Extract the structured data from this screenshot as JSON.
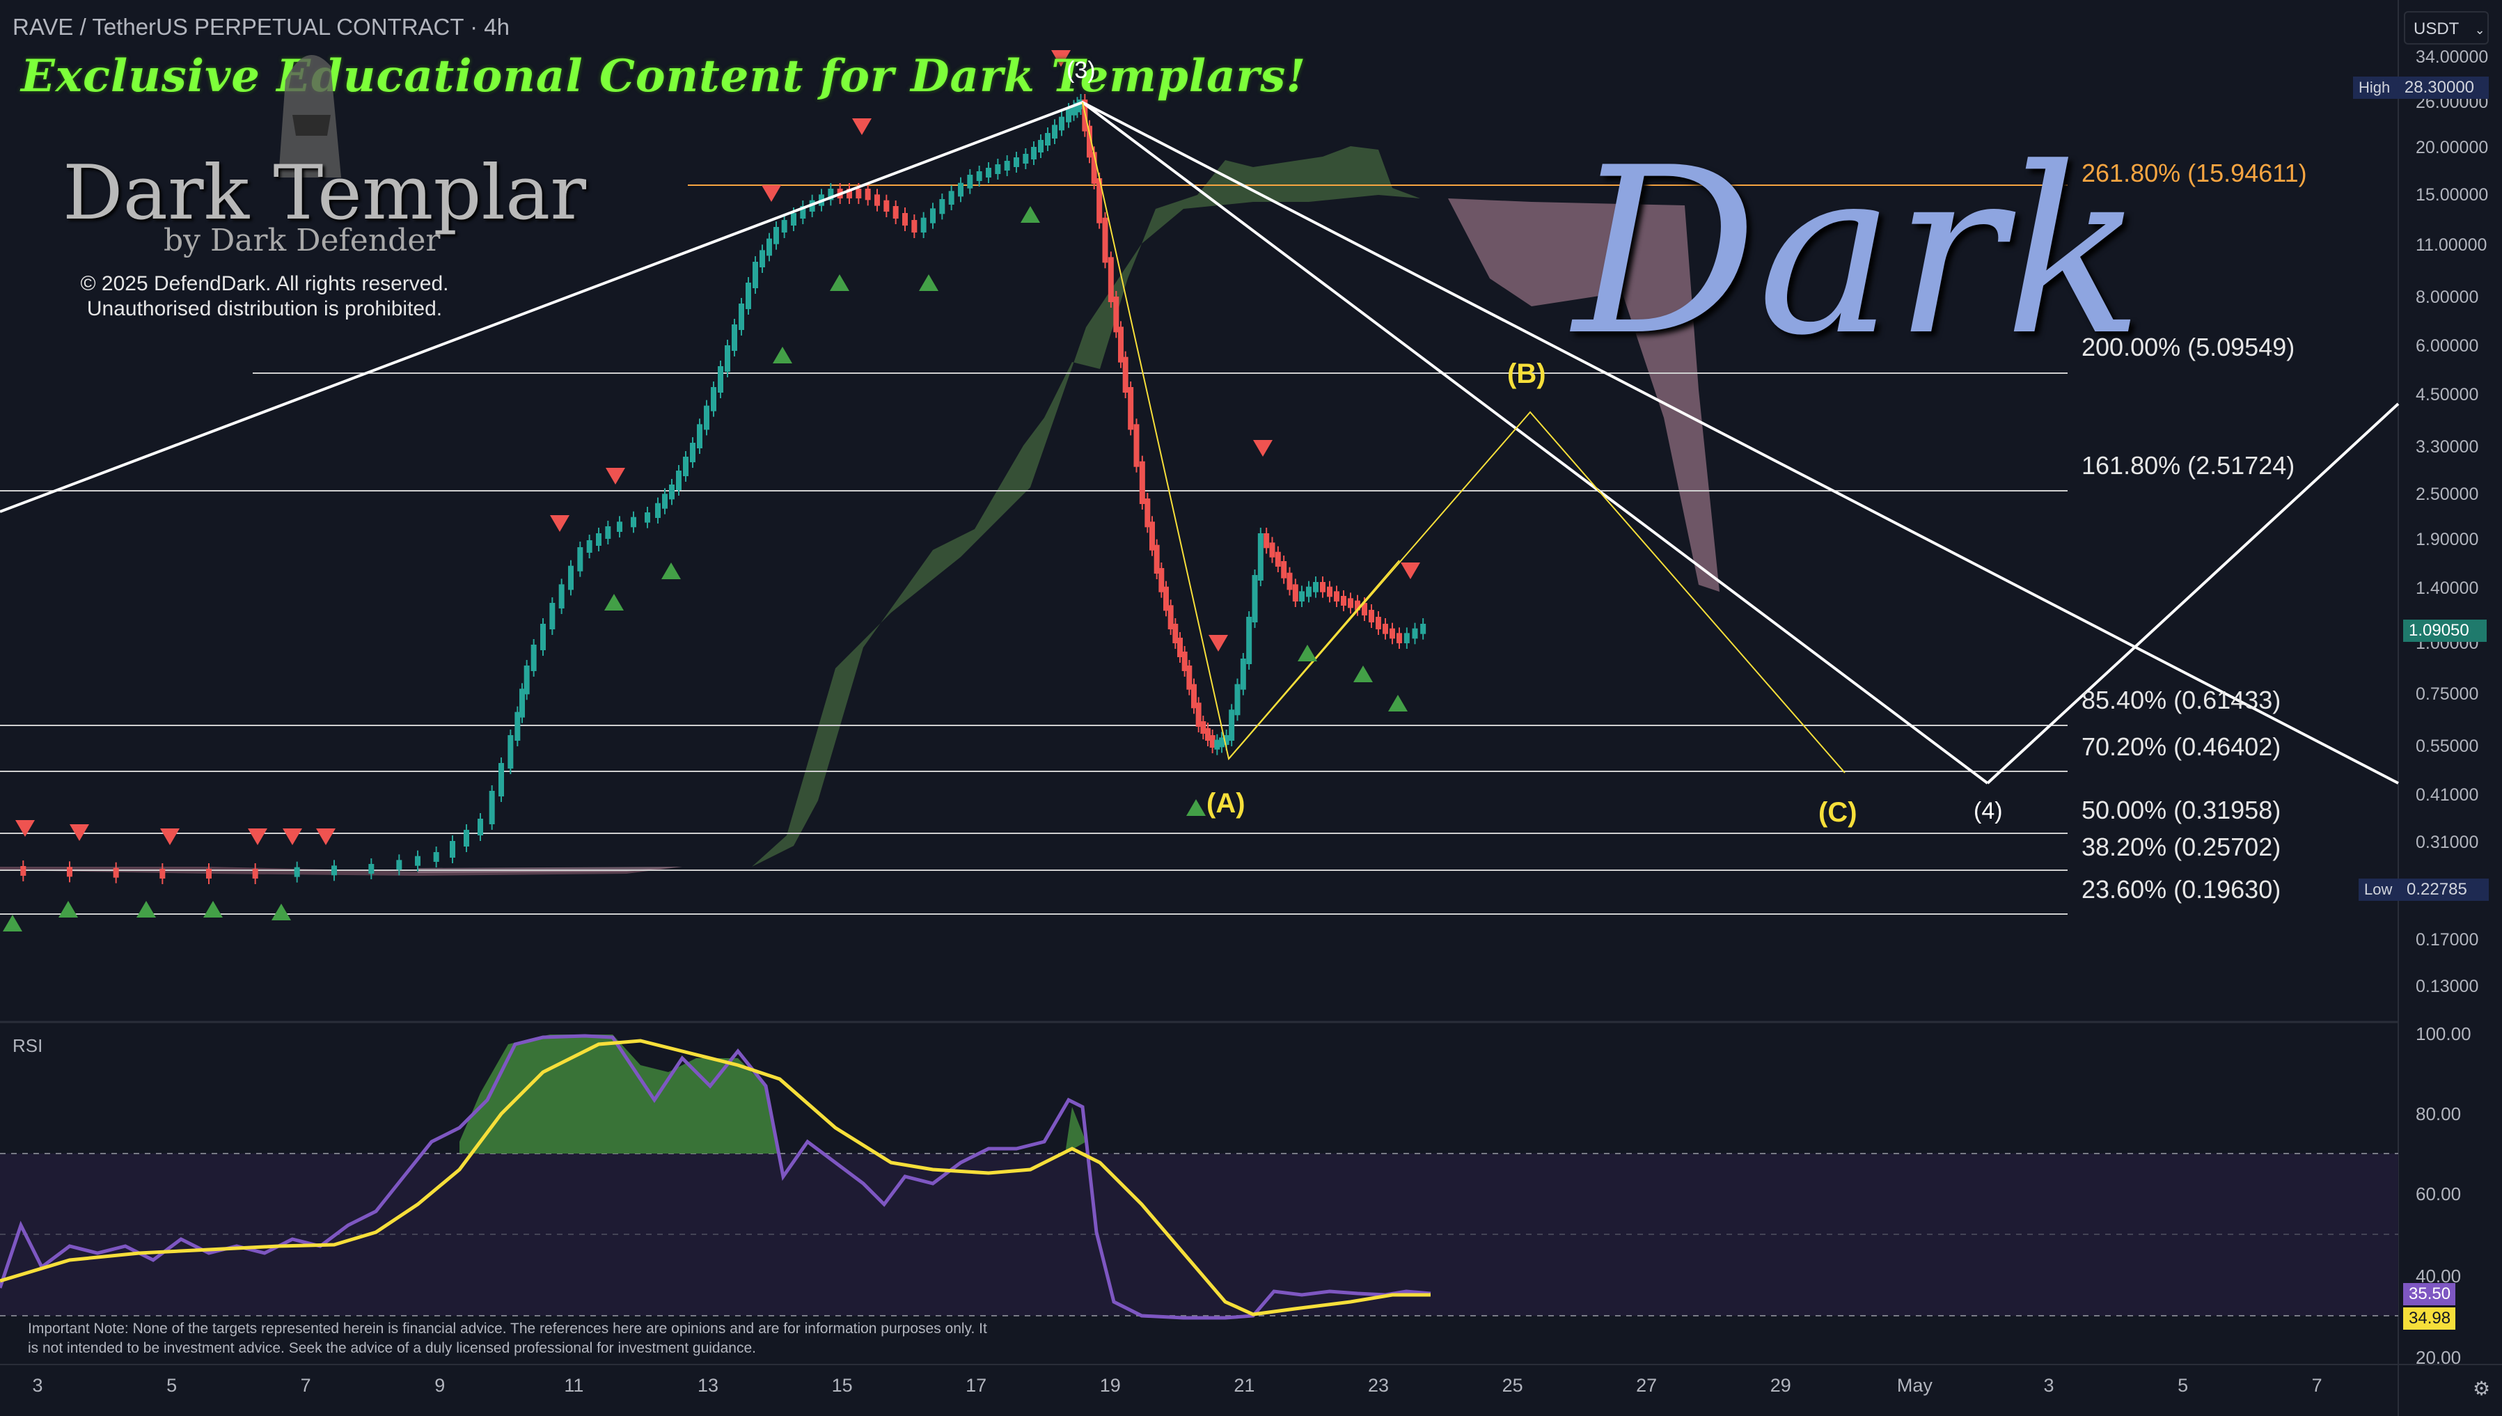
{
  "header": {
    "symbol_title": "RAVE / TetherUS PERPETUAL CONTRACT · 4h",
    "currency_button": "USDT"
  },
  "overlay": {
    "promo_text": "Exclusive Educational Content for Dark Templars!",
    "brand_name": "Dark Templar",
    "brand_sub": "by Dark Defender",
    "copyright_line1": "© 2025 DefendDark. All rights reserved.",
    "copyright_line2": "Unauthorised distribution is prohibited.",
    "watermark": "Dark",
    "note": "Important Note: None of the targets represented herein is financial advice. The references here are opinions and are for information purposes only. It is not intended to be investment advice. Seek the advice of a duly licensed professional for investment guidance."
  },
  "price_axis": {
    "ticks": [
      "34.00000",
      "26.00000",
      "20.00000",
      "15.00000",
      "11.00000",
      "8.00000",
      "6.00000",
      "4.50000",
      "3.30000",
      "2.50000",
      "1.90000",
      "1.40000",
      "1.00000",
      "0.75000",
      "0.55000",
      "0.41000",
      "0.31000",
      "0.17000",
      "0.13000"
    ],
    "high_label": "High",
    "high_value": "28.30000",
    "current_value": "1.09050",
    "low_label": "Low",
    "low_value": "0.22785"
  },
  "fib_levels": [
    {
      "label": "261.80% (15.94611)",
      "color": "#f7a541"
    },
    {
      "label": "200.00% (5.09549)",
      "color": "#e7e7e7"
    },
    {
      "label": "161.80% (2.51724)",
      "color": "#e7e7e7"
    },
    {
      "label": "85.40% (0.61433)",
      "color": "#e7e7e7"
    },
    {
      "label": "70.20% (0.46402)",
      "color": "#e7e7e7"
    },
    {
      "label": "50.00% (0.31958)",
      "color": "#e7e7e7"
    },
    {
      "label": "38.20% (0.25702)",
      "color": "#e7e7e7"
    },
    {
      "label": "23.60% (0.19630)",
      "color": "#e7e7e7"
    }
  ],
  "waves": {
    "w3": "(3)",
    "A": "(A)",
    "B": "(B)",
    "C": "(C)",
    "w4": "(4)"
  },
  "rsi": {
    "label": "RSI",
    "axis": [
      "100.00",
      "80.00",
      "60.00",
      "40.00",
      "20.00"
    ],
    "rsi_value": "35.50",
    "ma_value": "34.98"
  },
  "x_axis": [
    "3",
    "5",
    "7",
    "9",
    "11",
    "13",
    "15",
    "17",
    "19",
    "21",
    "23",
    "25",
    "27",
    "29",
    "May",
    "3",
    "5",
    "7"
  ],
  "colors": {
    "background": "#131722",
    "up_candle": "#26a69a",
    "down_candle": "#ef5350",
    "promo_green": "#7dff3a",
    "rsi_line": "#7e57c2",
    "rsi_ma": "#f7df3a"
  }
}
